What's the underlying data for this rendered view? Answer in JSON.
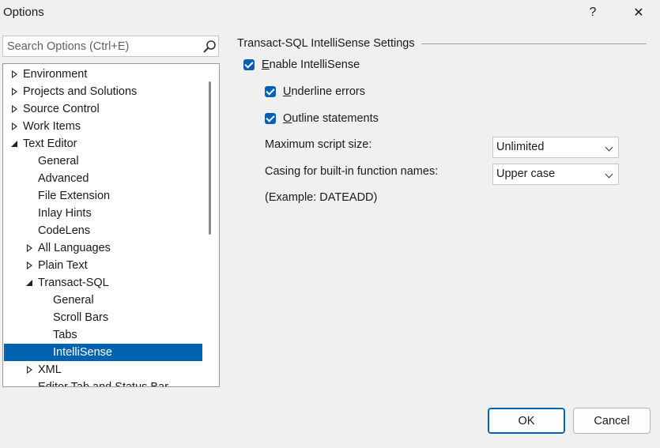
{
  "window": {
    "title": "Options",
    "help_glyph": "?",
    "close_glyph": "✕"
  },
  "search": {
    "placeholder": "Search Options (Ctrl+E)"
  },
  "tree": {
    "items": [
      {
        "label": "Environment",
        "expander": "collapsed"
      },
      {
        "label": "Projects and Solutions",
        "expander": "collapsed"
      },
      {
        "label": "Source Control",
        "expander": "collapsed"
      },
      {
        "label": "Work Items",
        "expander": "collapsed"
      },
      {
        "label": "Text Editor",
        "expander": "expanded"
      },
      {
        "label": "General",
        "expander": "none"
      },
      {
        "label": "Advanced",
        "expander": "none"
      },
      {
        "label": "File Extension",
        "expander": "none"
      },
      {
        "label": "Inlay Hints",
        "expander": "none"
      },
      {
        "label": "CodeLens",
        "expander": "none"
      },
      {
        "label": "All Languages",
        "expander": "collapsed"
      },
      {
        "label": "Plain Text",
        "expander": "collapsed"
      },
      {
        "label": "Transact-SQL",
        "expander": "expanded"
      },
      {
        "label": "General",
        "expander": "none"
      },
      {
        "label": "Scroll Bars",
        "expander": "none"
      },
      {
        "label": "Tabs",
        "expander": "none"
      },
      {
        "label": "IntelliSense",
        "expander": "none",
        "selected": true
      },
      {
        "label": "XML",
        "expander": "collapsed"
      },
      {
        "label": "Editor Tab and Status Bar",
        "expander": "none"
      }
    ]
  },
  "settings": {
    "section_title": "Transact-SQL IntelliSense Settings",
    "enable_intellisense": {
      "first_letter": "E",
      "rest": "nable IntelliSense",
      "checked": true
    },
    "underline_errors": {
      "first_letter": "U",
      "rest": "nderline errors",
      "checked": true
    },
    "outline_statements": {
      "first_letter": "O",
      "rest": "utline statements",
      "checked": true
    },
    "max_script_size": {
      "label": "Maximum script size:",
      "value": "Unlimited"
    },
    "casing": {
      "label": "Casing for built-in function names:",
      "value": "Upper case"
    },
    "example": "(Example: DATEADD)"
  },
  "buttons": {
    "ok": "OK",
    "cancel": "Cancel"
  },
  "colors": {
    "accent": "#005fb8",
    "selection": "#0063b1",
    "background": "#f0f0f0"
  }
}
